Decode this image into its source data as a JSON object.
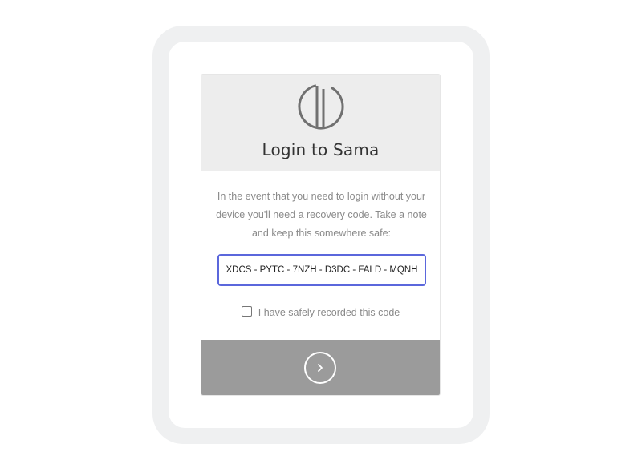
{
  "card": {
    "logo_icon": "sama-logo-icon",
    "title": "Login to Sama",
    "description": "In the event that you need to login without your device you'll need a recovery code. Take a note and keep this somewhere safe:",
    "recovery_code": "XDCS - PYTC - 7NZH - D3DC - FALD - MQNH",
    "checkbox_label": "I have safely recorded this code",
    "checkbox_checked": false,
    "next_icon": "chevron-right-icon"
  },
  "colors": {
    "frame_bg": "#eff0f1",
    "header_bg": "#ededed",
    "footer_bg": "#9b9b9b",
    "code_border": "#5b67dc"
  }
}
